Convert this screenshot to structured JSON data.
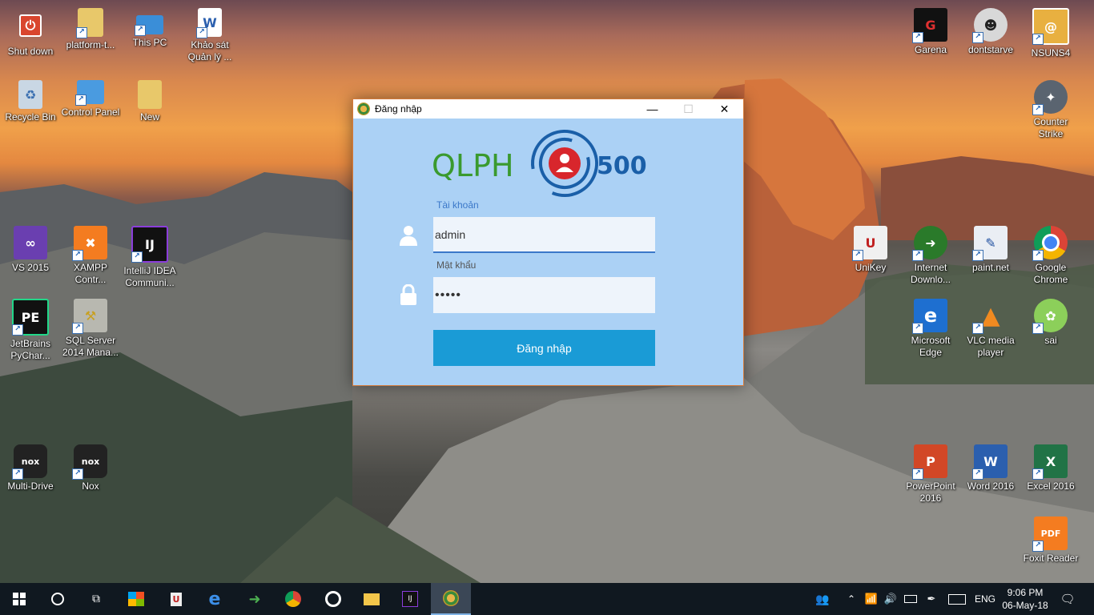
{
  "desktop_icons": {
    "shutdown": "Shut down",
    "platform": "platform-t...",
    "thispc": "This PC",
    "khaosat": "Khảo sát Quản lý ...",
    "recycle": "Recycle Bin",
    "controlpanel": "Control Panel",
    "new": "New",
    "vs2015": "VS 2015",
    "xampp": "XAMPP Contr...",
    "intellij": "IntelliJ IDEA Communi...",
    "pycharm": "JetBrains PyChar...",
    "sqlserver": "SQL Server 2014 Mana...",
    "multidrive": "Multi-Drive",
    "nox": "Nox",
    "garena": "Garena",
    "dontstarve": "dontstarve",
    "nsuns4": "NSUNS4",
    "counterstrike": "Counter Strike",
    "unikey": "UniKey",
    "idm": "Internet Downlo...",
    "paintnet": "paint.net",
    "chrome": "Google Chrome",
    "edge": "Microsoft Edge",
    "vlc": "VLC media player",
    "sai": "sai",
    "powerpoint": "PowerPoint 2016",
    "word": "Word 2016",
    "excel": "Excel 2016",
    "foxit": "Foxit Reader"
  },
  "window": {
    "title": "Đăng nhập",
    "logo_left": "QLPH",
    "logo_right": "500",
    "username_label": "Tài khoản",
    "username_value": "admin",
    "password_label": "Mật khẩu",
    "password_value": "•••••",
    "login_button": "Đăng nhập"
  },
  "taskbar": {
    "lang": "ENG",
    "time": "9:06 PM",
    "date": "06-May-18"
  },
  "colors": {
    "window_bg": "#abd1f5",
    "button_bg": "#1a9bd6",
    "logo_green": "#3a9a2e",
    "logo_blue": "#1a5fa8",
    "logo_red": "#d8262c",
    "taskbar_bg": "#101820"
  }
}
